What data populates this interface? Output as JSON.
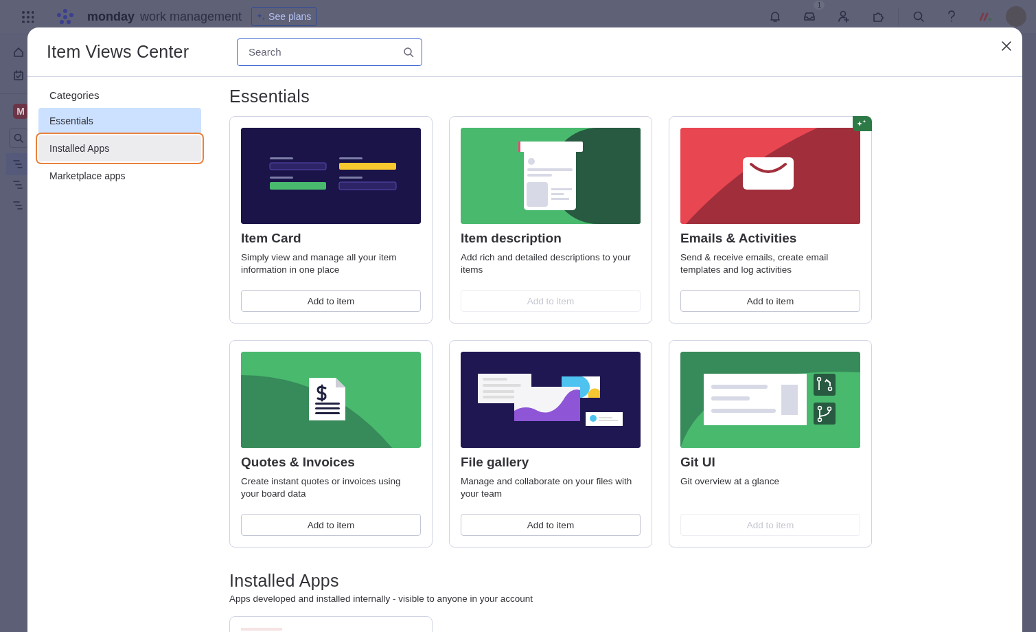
{
  "app_bar": {
    "brand": "monday",
    "product": "work management",
    "plans_button": "See plans",
    "inbox_badge": "1"
  },
  "rail": {
    "workspace_initial": "M"
  },
  "modal": {
    "title": "Item Views Center",
    "search": {
      "placeholder": "Search"
    }
  },
  "sidebar": {
    "heading": "Categories",
    "items": [
      {
        "label": "Essentials",
        "selected": true,
        "focused": false
      },
      {
        "label": "Installed Apps",
        "selected": false,
        "focused": true
      },
      {
        "label": "Marketplace apps",
        "selected": false,
        "focused": false
      }
    ]
  },
  "sections": [
    {
      "title": "Essentials",
      "cards": [
        {
          "kind": "item-card",
          "title": "Item Card",
          "description": "Simply view and manage all your item information in one place",
          "button": "Add to item",
          "disabled": false,
          "featured": false
        },
        {
          "kind": "description",
          "title": "Item description",
          "description": "Add rich and detailed descriptions to your items",
          "button": "Add to item",
          "disabled": true,
          "featured": false
        },
        {
          "kind": "emails",
          "title": "Emails & Activities",
          "description": "Send & receive emails, create email templates and log activities",
          "button": "Add to item",
          "disabled": false,
          "featured": true
        },
        {
          "kind": "quotes",
          "title": "Quotes & Invoices",
          "description": "Create instant quotes or invoices using your board data",
          "button": "Add to item",
          "disabled": false,
          "featured": false
        },
        {
          "kind": "gallery",
          "title": "File gallery",
          "description": "Manage and collaborate on your files with your team",
          "button": "Add to item",
          "disabled": false,
          "featured": false
        },
        {
          "kind": "git",
          "title": "Git UI",
          "description": "Git overview at a glance",
          "button": "Add to item",
          "disabled": true,
          "featured": false
        }
      ]
    },
    {
      "title": "Installed Apps",
      "subtitle": "Apps developed and installed internally - visible to anyone in your account"
    }
  ]
}
